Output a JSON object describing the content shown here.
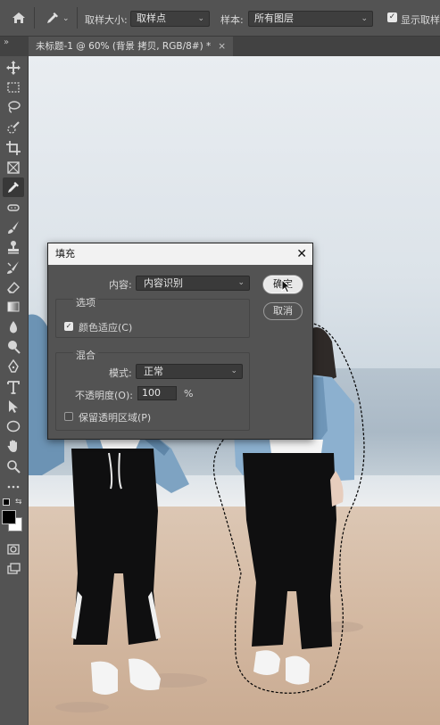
{
  "options_bar": {
    "sample_size_label": "取样大小:",
    "sample_size_value": "取样点",
    "sample_label": "样本:",
    "sample_value": "所有图层",
    "show_ring_label": "显示取样环"
  },
  "document_tab": {
    "title": "未标题-1 @ 60% (背景 拷贝, RGB/8#) *",
    "close": "×"
  },
  "dialog": {
    "title": "填充",
    "close": "✕",
    "content_label": "内容:",
    "content_value": "内容识别",
    "options_group": "选项",
    "color_adapt_label": "颜色适应(C)",
    "blend_group": "混合",
    "mode_label": "模式:",
    "mode_value": "正常",
    "opacity_label": "不透明度(O):",
    "opacity_value": "100",
    "opacity_unit": "%",
    "preserve_label": "保留透明区域(P)",
    "ok_label": "确定",
    "cancel_label": "取消"
  },
  "colors": {
    "dialog_bg": "#535353",
    "titlebar": "#f2f2f2",
    "foreground_swatch": "#000000",
    "background_swatch": "#ffffff",
    "selection_marquee": "#000000"
  },
  "icons": [
    "home-icon",
    "eyedropper-icon",
    "move-icon",
    "marquee-icon",
    "lasso-icon",
    "quick-select-icon",
    "crop-icon",
    "frame-icon",
    "eyedropper-tool-icon",
    "spot-healing-icon",
    "brush-icon",
    "stamp-icon",
    "history-brush-icon",
    "eraser-icon",
    "gradient-icon",
    "blur-icon",
    "dodge-icon",
    "pen-icon",
    "type-icon",
    "path-select-icon",
    "ellipse-icon",
    "hand-icon",
    "zoom-icon",
    "more-icon",
    "color-swatch-icon",
    "quick-mask-icon",
    "screen-mode-icon"
  ]
}
